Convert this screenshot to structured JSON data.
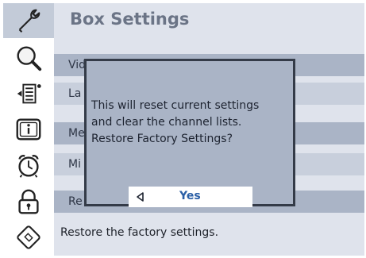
{
  "sidebar": {
    "items": [
      {
        "icon": "wrench-icon",
        "active": true
      },
      {
        "icon": "search-icon",
        "active": false
      },
      {
        "icon": "channel-list-icon",
        "active": false
      },
      {
        "icon": "info-icon",
        "active": false
      },
      {
        "icon": "alarm-clock-icon",
        "active": false
      },
      {
        "icon": "lock-icon",
        "active": false
      },
      {
        "icon": "smart-card-icon",
        "active": false
      }
    ]
  },
  "main": {
    "title": "Box Settings",
    "menu": [
      {
        "label": "Video Settings"
      },
      {
        "label": "La"
      },
      {
        "label": "Me"
      },
      {
        "label": "Mi"
      },
      {
        "label": "Re"
      }
    ],
    "help_text": "Restore the factory settings."
  },
  "dialog": {
    "lines": [
      "This will reset current settings",
      "and clear the channel lists.",
      "Restore Factory Settings?"
    ],
    "yes_label": "Yes"
  },
  "colors": {
    "accent": "#2a5fa6",
    "panel": "#aab4c6",
    "highlight_row": "#c8cfdc",
    "dialog_border": "#343b48"
  }
}
